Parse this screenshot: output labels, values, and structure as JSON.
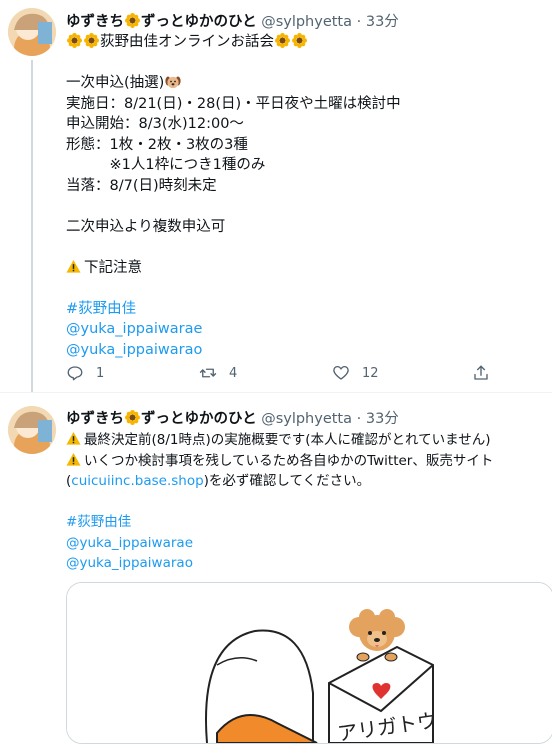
{
  "tweets": [
    {
      "display_name": "ゆずきち",
      "display_name_suffix": "ずっとゆかのひと",
      "handle": "@sylphyetta",
      "time": "33分",
      "lines": {
        "l1": "荻野由佳オンラインお話会",
        "l3": "一次申込(抽選)",
        "l4": "実施日：8/21(日)・28(日)・平日夜や土曜は検討中",
        "l5": "申込開始：8/3(水)12:00～",
        "l6": "形態：1枚・2枚・3枚の3種",
        "l7": "　　　※1人1枠につき1種のみ",
        "l8": "当落：8/7(日)時刻未定",
        "l10": "二次申込より複数申込可",
        "l12": "下記注意",
        "hashtag": "#荻野由佳",
        "mention1": "@yuka_ippaiwarae",
        "mention2": "@yuka_ippaiwarao"
      },
      "actions": {
        "reply_count": "1",
        "retweet_count": "4",
        "like_count": "12"
      }
    },
    {
      "display_name": "ゆずきち",
      "display_name_suffix": "ずっとゆかのひと",
      "handle": "@sylphyetta",
      "time": "33分",
      "lines": {
        "l1": "最終決定前(8/1時点)の実施概要です(本人に確認がとれていません)",
        "l2": "いくつか検討事項を残しているため各自ゆかのTwitter、販売サイト",
        "l3_link": "cuicuiinc.base.shop",
        "l3_rest": ")を必ず確認してください。",
        "l3_open": "(",
        "hashtag": "#荻野由佳",
        "mention1": "@yuka_ippaiwarae",
        "mention2": "@yuka_ippaiwarao"
      },
      "image_text": "アリガトウ"
    }
  ],
  "colors": {
    "link": "#1d9bf0",
    "muted": "#536471",
    "text": "#0f1419"
  }
}
